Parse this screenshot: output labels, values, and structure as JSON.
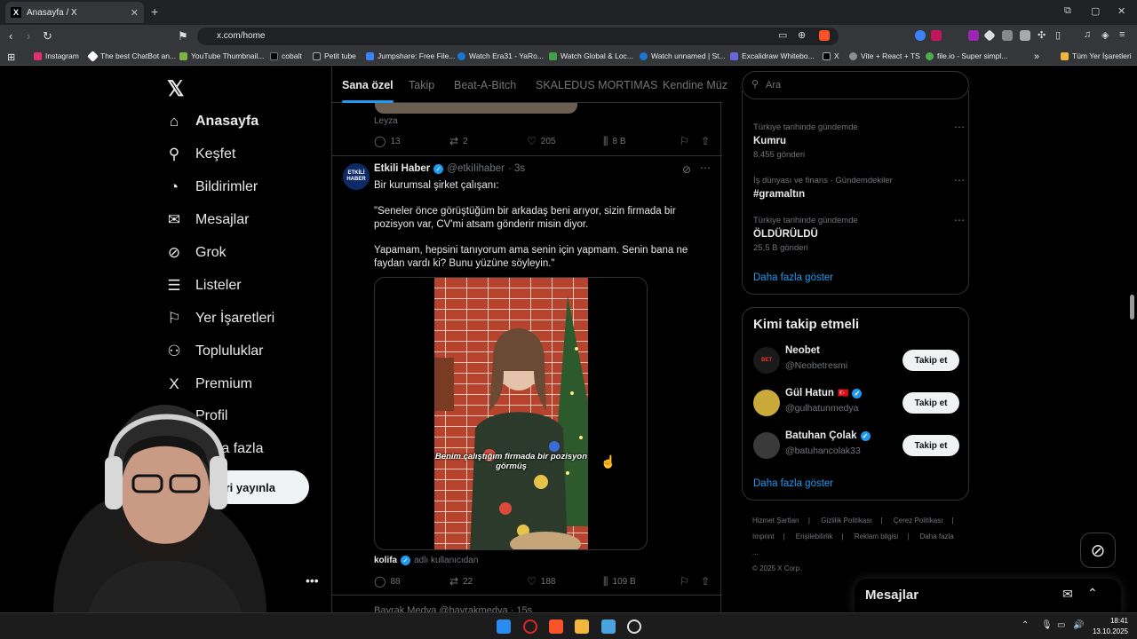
{
  "browser": {
    "tab_title": "Anasayfa / X",
    "tab_close": "✕",
    "new_tab": "+",
    "url": "x.com/home",
    "bookmarks": [
      {
        "label": "Instagram",
        "color": "#e1306c"
      },
      {
        "label": "The best ChatBot an...",
        "color": "#ffffff"
      },
      {
        "label": "YouTube Thumbnail...",
        "color": "#7cb342"
      },
      {
        "label": "cobalt",
        "color": "#000000"
      },
      {
        "label": "Petit tube",
        "color": "#222222"
      },
      {
        "label": "Jumpshare: Free File...",
        "color": "#3b82f6"
      },
      {
        "label": "Watch Era31 - YaRo...",
        "color": "#1976d2"
      },
      {
        "label": "Watch Global & Loc...",
        "color": "#43a047"
      },
      {
        "label": "Watch unnamed | St...",
        "color": "#1976d2"
      },
      {
        "label": "Excalidraw Whitebo...",
        "color": "#6965db"
      },
      {
        "label": "X",
        "color": "#000000"
      },
      {
        "label": "Vite + React + TS",
        "color": "#8e8e8e"
      },
      {
        "label": "file.io - Super simpl...",
        "color": "#4caf50"
      }
    ],
    "all_bookmarks": "Tüm Yer İşaretleri"
  },
  "nav": {
    "items": [
      {
        "label": "Anasayfa",
        "icon": "home-icon",
        "glyph": "⌂"
      },
      {
        "label": "Keşfet",
        "icon": "search-icon",
        "glyph": "⚲"
      },
      {
        "label": "Bildirimler",
        "icon": "bell-icon",
        "glyph": "🔔"
      },
      {
        "label": "Mesajlar",
        "icon": "mail-icon",
        "glyph": "✉"
      },
      {
        "label": "Grok",
        "icon": "grok-icon",
        "glyph": "⊘"
      },
      {
        "label": "Listeler",
        "icon": "list-icon",
        "glyph": "☰"
      },
      {
        "label": "Yer İşaretleri",
        "icon": "bookmark-icon",
        "glyph": "⚑"
      },
      {
        "label": "Topluluklar",
        "icon": "communities-icon",
        "glyph": "👥"
      },
      {
        "label": "Premium",
        "icon": "x-premium-icon",
        "glyph": "X"
      },
      {
        "label": "Profil",
        "icon": "profile-icon",
        "glyph": "👤"
      },
      {
        "label": "Daha fazla",
        "icon": "more-icon",
        "glyph": "⋯"
      }
    ],
    "post_button": "Gönderi yayınla",
    "post_button_visible": "ri yayınla"
  },
  "feed": {
    "tabs": [
      "Sana özel",
      "Takip",
      "Beat-A-Bitch",
      "SKALEDUS MORTIMAS",
      "Kendine Müz"
    ],
    "prev_post": {
      "name": "Leyza",
      "replies": "13",
      "reposts": "2",
      "likes": "205",
      "views": "8 B"
    },
    "tweet": {
      "avatar_text": "ETKİLİ HABER",
      "name": "Etkili Haber",
      "handle": "@etkiIihaber",
      "time": "· 3s",
      "line1": "Bir kurumsal şirket çalışanı:",
      "para2": "\"Seneler önce görüştüğüm bir arkadaş beni arıyor, sizin firmada bir pozisyon var, CV'mi atsam gönderir misin diyor.",
      "para3": "Yapamam, hepsini tanıyorum ama senin için yapmam. Senin bana ne faydan vardı ki? Bunu yüzüne söyleyin.\"",
      "video_caption": "Benim çalıştığım firmada bir pozisyon görmüş",
      "credit_user": "kolifa",
      "credit_text": "adlı kullanıcıdan",
      "replies": "88",
      "reposts": "22",
      "likes": "188",
      "views": "109 B"
    },
    "next_post": "Bayrak Medya  @bayrakmedya · 15s"
  },
  "right": {
    "search_placeholder": "Ara",
    "trends": [
      {
        "context": "Türkiye tarihinde gündemde",
        "title": "Kumru",
        "count": "8.455 gönderi"
      },
      {
        "context": "İş dünyası ve finans · Gündemdekiler",
        "title": "#gramaltın",
        "count": ""
      },
      {
        "context": "Türkiye tarihinde gündemde",
        "title": "ÖLDÜRÜLDÜ",
        "count": "25,5 B gönderi"
      }
    ],
    "show_more": "Daha fazla göster",
    "who_to_follow_title": "Kimi takip etmeli",
    "follow_suggestions": [
      {
        "name": "Neobet",
        "handle": "@Neobetresmi",
        "verified": false,
        "flag": "",
        "avatar_color": "#1a1a1a"
      },
      {
        "name": "Gül Hatun",
        "handle": "@gulhatunmedya",
        "verified": true,
        "flag": "🇹🇷",
        "avatar_color": "#c8a93a"
      },
      {
        "name": "Batuhan Çolak",
        "handle": "@batuhancolak33",
        "verified": true,
        "flag": "",
        "avatar_color": "#3a3a3a"
      }
    ],
    "follow_button": "Takip et",
    "footer_links": [
      "Hizmet Şartları",
      "|",
      "Gizlilik Politikası",
      "|",
      "Çerez Politikası",
      "|",
      "Imprint",
      "|",
      "Erişilebilirlik",
      "|",
      "Reklam bilgisi",
      "|",
      "Daha fazla ..."
    ],
    "copyright": "© 2025 X Corp."
  },
  "messages_dock": {
    "title": "Mesajlar"
  },
  "taskbar": {
    "time": "18:41",
    "date": "13.10.2025"
  },
  "colors": {
    "accent": "#1d9bf0",
    "text": "#e7e9ea",
    "muted": "#71767b",
    "border": "#2f3336"
  }
}
